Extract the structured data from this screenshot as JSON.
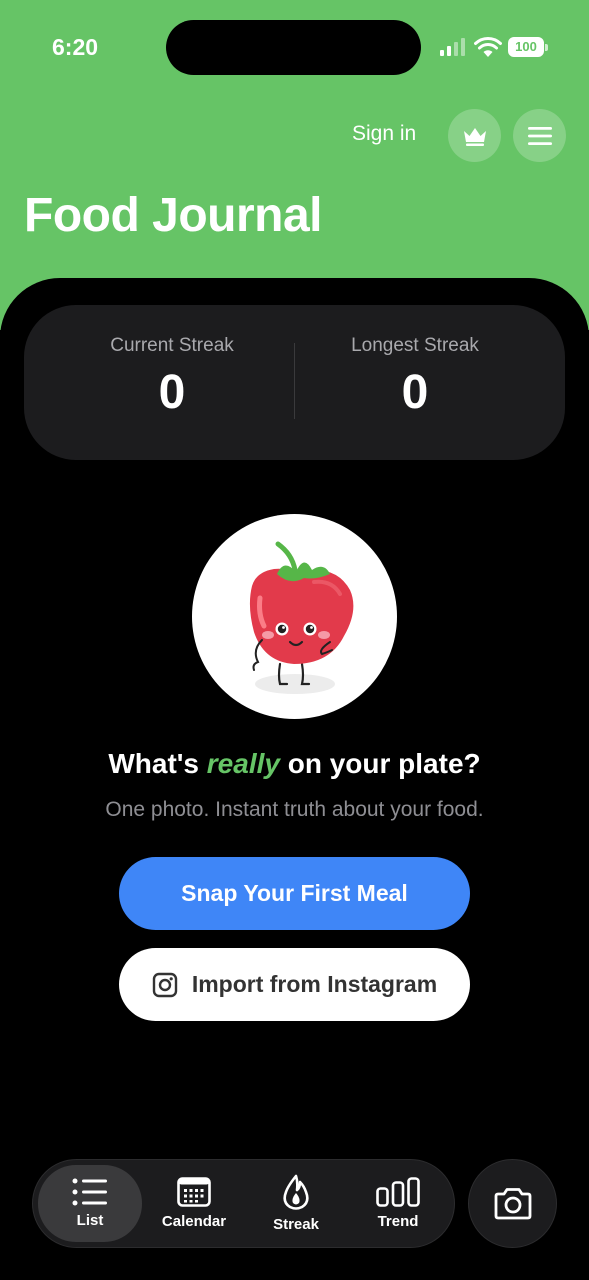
{
  "status_bar": {
    "time": "6:20",
    "battery": "100"
  },
  "header": {
    "sign_in": "Sign in",
    "title": "Food Journal",
    "crown_icon": "crown-icon",
    "menu_icon": "hamburger-menu-icon"
  },
  "streaks": {
    "current_label": "Current Streak",
    "current_value": "0",
    "longest_label": "Longest Streak",
    "longest_value": "0"
  },
  "hero": {
    "illustration": "tomato-mascot",
    "headline_before": "What's ",
    "headline_emphasis": "really",
    "headline_after": " on your plate?",
    "subline": "One photo. Instant truth about your food."
  },
  "actions": {
    "primary": "Snap Your First Meal",
    "secondary": "Import from Instagram",
    "secondary_icon": "instagram-icon"
  },
  "tabbar": {
    "tabs": [
      {
        "label": "List",
        "icon": "list-icon",
        "active": true
      },
      {
        "label": "Calendar",
        "icon": "calendar-icon",
        "active": false
      },
      {
        "label": "Streak",
        "icon": "flame-icon",
        "active": false
      },
      {
        "label": "Trend",
        "icon": "bar-chart-icon",
        "active": false
      }
    ],
    "camera_icon": "camera-icon"
  },
  "colors": {
    "brand_green": "#66c466",
    "primary_blue": "#3f86f7",
    "card_bg": "#1c1c1e"
  }
}
